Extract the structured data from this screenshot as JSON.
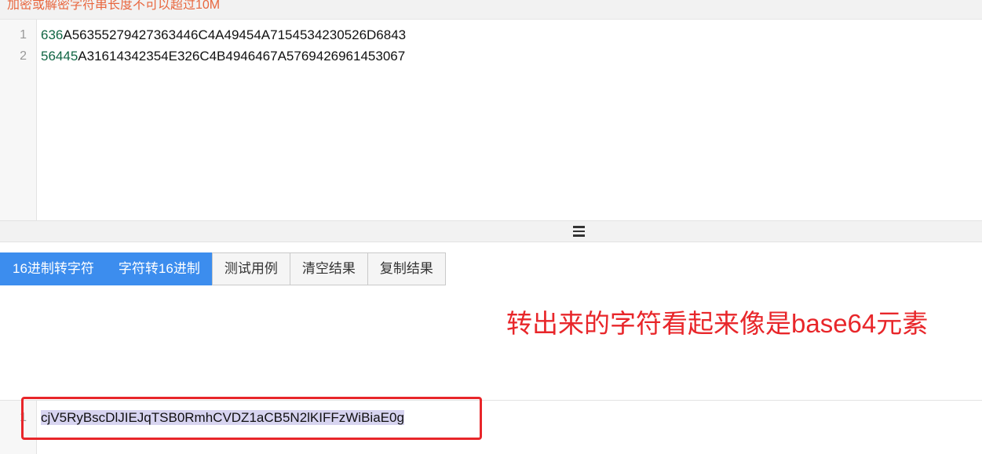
{
  "top_hint": "加密或解密字符串长度不可以超过10M",
  "input_editor": {
    "lines": [
      {
        "number": "1",
        "num_prefix": "636",
        "rest": "A56355279427363446C4A49454A7154534230526D6843"
      },
      {
        "number": "2",
        "num_prefix": "56445",
        "rest": "A31614342354E326C4B4946467A5769426961453067"
      }
    ]
  },
  "splitter": {
    "icon": "menu-icon"
  },
  "toolbar": {
    "hex_to_string_label": "16进制转字符",
    "string_to_hex_label": "字符转16进制",
    "test_case_label": "测试用例",
    "clear_label": "清空结果",
    "copy_label": "复制结果"
  },
  "annotation_text": "转出来的字符看起来像是base64元素",
  "output_editor": {
    "lines": [
      {
        "number": "1",
        "text": "cjV5RyBscDlJIEJqTSB0RmhCVDZ1aCB5N2lKIFFzWiBiaE0g"
      }
    ]
  },
  "colors": {
    "primary_button": "#3c8dee",
    "annotation_red": "#e8262a",
    "hint_orange": "#e8673f",
    "number_green": "#116644",
    "selection": "#d7d4f0"
  }
}
